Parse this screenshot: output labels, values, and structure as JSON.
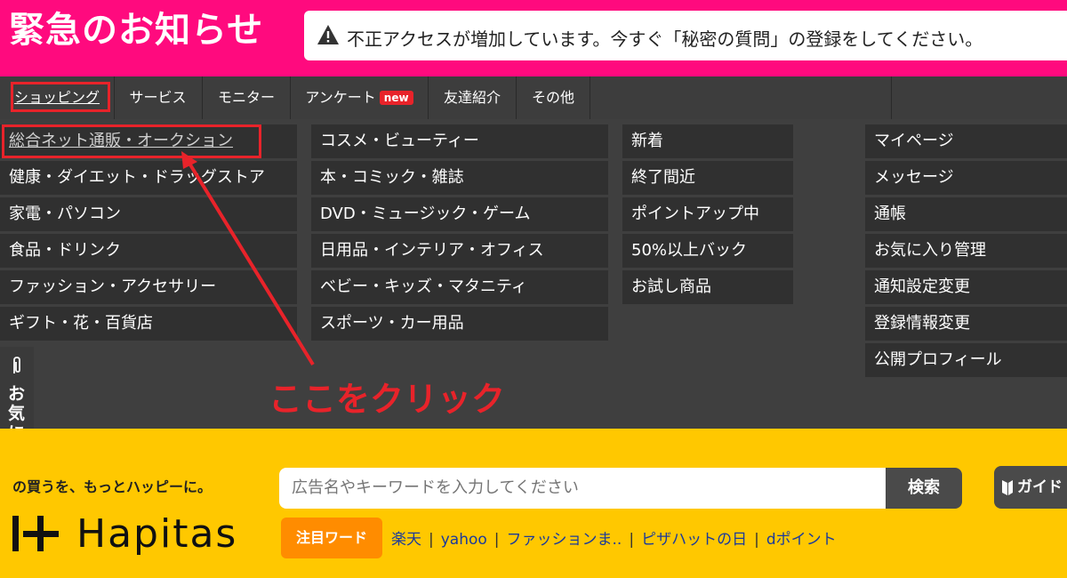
{
  "header": {
    "title": "緊急のお知らせ",
    "alert": {
      "icon": "warning-icon",
      "message": "不正アクセスが増加しています。今すぐ「秘密の質問」の登録をしてください。",
      "more_icon": "chevron-right-icon"
    }
  },
  "nav": {
    "tabs": [
      {
        "label": "ショッピング"
      },
      {
        "label": "サービス"
      },
      {
        "label": "モニター"
      },
      {
        "label": "アンケート",
        "badge": "new"
      },
      {
        "label": "友達紹介"
      },
      {
        "label": "その他"
      }
    ]
  },
  "menu": {
    "col1": [
      "総合ネット通販・オークション",
      "健康・ダイエット・ドラッグストア",
      "家電・パソコン",
      "食品・ドリンク",
      "ファッション・アクセサリー",
      "ギフト・花・百貨店"
    ],
    "col2": [
      "コスメ・ビューティー",
      "本・コミック・雑誌",
      "DVD・ミュージック・ゲーム",
      "日用品・インテリア・オフィス",
      "ベビー・キッズ・マタニティ",
      "スポーツ・カー用品"
    ],
    "col3": [
      "新着",
      "終了間近",
      "ポイントアップ中",
      "50%以上バック",
      "お試し商品"
    ],
    "col4": [
      "マイページ",
      "メッセージ",
      "通帳",
      "お気に入り管理",
      "通知設定変更",
      "登録情報変更",
      "公開プロフィール"
    ]
  },
  "annotation": {
    "callout": "ここをクリック",
    "color": "#e8232a"
  },
  "favorites_tab": {
    "label": "お気に入り",
    "icon": "paperclip-icon"
  },
  "footer": {
    "tagline": "の買うを、もっとハッピーに。",
    "logo": "Hapitas",
    "search": {
      "placeholder": "広告名やキーワードを入力してください",
      "button": "検索"
    },
    "guide_button": "ガイド",
    "trending_label": "注目ワード",
    "trending": [
      "楽天",
      "yahoo",
      "ファッションま..",
      "ピザハットの日",
      "dポイント"
    ]
  },
  "colors": {
    "brand_pink": "#ff0a7e",
    "brand_yellow": "#ffc800",
    "accent_orange": "#ff8c00",
    "menu_bg": "#303030"
  }
}
